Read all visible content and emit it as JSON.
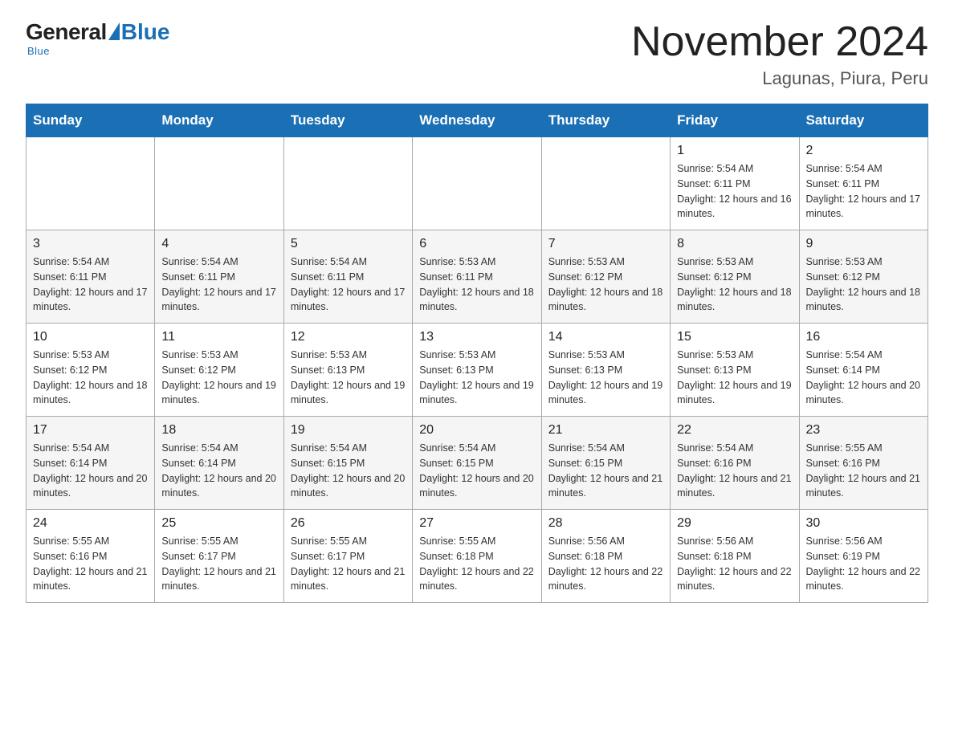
{
  "logo": {
    "general": "General",
    "blue": "Blue",
    "sub": "Blue"
  },
  "title": "November 2024",
  "subtitle": "Lagunas, Piura, Peru",
  "days_of_week": [
    "Sunday",
    "Monday",
    "Tuesday",
    "Wednesday",
    "Thursday",
    "Friday",
    "Saturday"
  ],
  "weeks": [
    [
      {
        "day": "",
        "sunrise": "",
        "sunset": "",
        "daylight": ""
      },
      {
        "day": "",
        "sunrise": "",
        "sunset": "",
        "daylight": ""
      },
      {
        "day": "",
        "sunrise": "",
        "sunset": "",
        "daylight": ""
      },
      {
        "day": "",
        "sunrise": "",
        "sunset": "",
        "daylight": ""
      },
      {
        "day": "",
        "sunrise": "",
        "sunset": "",
        "daylight": ""
      },
      {
        "day": "1",
        "sunrise": "Sunrise: 5:54 AM",
        "sunset": "Sunset: 6:11 PM",
        "daylight": "Daylight: 12 hours and 16 minutes."
      },
      {
        "day": "2",
        "sunrise": "Sunrise: 5:54 AM",
        "sunset": "Sunset: 6:11 PM",
        "daylight": "Daylight: 12 hours and 17 minutes."
      }
    ],
    [
      {
        "day": "3",
        "sunrise": "Sunrise: 5:54 AM",
        "sunset": "Sunset: 6:11 PM",
        "daylight": "Daylight: 12 hours and 17 minutes."
      },
      {
        "day": "4",
        "sunrise": "Sunrise: 5:54 AM",
        "sunset": "Sunset: 6:11 PM",
        "daylight": "Daylight: 12 hours and 17 minutes."
      },
      {
        "day": "5",
        "sunrise": "Sunrise: 5:54 AM",
        "sunset": "Sunset: 6:11 PM",
        "daylight": "Daylight: 12 hours and 17 minutes."
      },
      {
        "day": "6",
        "sunrise": "Sunrise: 5:53 AM",
        "sunset": "Sunset: 6:11 PM",
        "daylight": "Daylight: 12 hours and 18 minutes."
      },
      {
        "day": "7",
        "sunrise": "Sunrise: 5:53 AM",
        "sunset": "Sunset: 6:12 PM",
        "daylight": "Daylight: 12 hours and 18 minutes."
      },
      {
        "day": "8",
        "sunrise": "Sunrise: 5:53 AM",
        "sunset": "Sunset: 6:12 PM",
        "daylight": "Daylight: 12 hours and 18 minutes."
      },
      {
        "day": "9",
        "sunrise": "Sunrise: 5:53 AM",
        "sunset": "Sunset: 6:12 PM",
        "daylight": "Daylight: 12 hours and 18 minutes."
      }
    ],
    [
      {
        "day": "10",
        "sunrise": "Sunrise: 5:53 AM",
        "sunset": "Sunset: 6:12 PM",
        "daylight": "Daylight: 12 hours and 18 minutes."
      },
      {
        "day": "11",
        "sunrise": "Sunrise: 5:53 AM",
        "sunset": "Sunset: 6:12 PM",
        "daylight": "Daylight: 12 hours and 19 minutes."
      },
      {
        "day": "12",
        "sunrise": "Sunrise: 5:53 AM",
        "sunset": "Sunset: 6:13 PM",
        "daylight": "Daylight: 12 hours and 19 minutes."
      },
      {
        "day": "13",
        "sunrise": "Sunrise: 5:53 AM",
        "sunset": "Sunset: 6:13 PM",
        "daylight": "Daylight: 12 hours and 19 minutes."
      },
      {
        "day": "14",
        "sunrise": "Sunrise: 5:53 AM",
        "sunset": "Sunset: 6:13 PM",
        "daylight": "Daylight: 12 hours and 19 minutes."
      },
      {
        "day": "15",
        "sunrise": "Sunrise: 5:53 AM",
        "sunset": "Sunset: 6:13 PM",
        "daylight": "Daylight: 12 hours and 19 minutes."
      },
      {
        "day": "16",
        "sunrise": "Sunrise: 5:54 AM",
        "sunset": "Sunset: 6:14 PM",
        "daylight": "Daylight: 12 hours and 20 minutes."
      }
    ],
    [
      {
        "day": "17",
        "sunrise": "Sunrise: 5:54 AM",
        "sunset": "Sunset: 6:14 PM",
        "daylight": "Daylight: 12 hours and 20 minutes."
      },
      {
        "day": "18",
        "sunrise": "Sunrise: 5:54 AM",
        "sunset": "Sunset: 6:14 PM",
        "daylight": "Daylight: 12 hours and 20 minutes."
      },
      {
        "day": "19",
        "sunrise": "Sunrise: 5:54 AM",
        "sunset": "Sunset: 6:15 PM",
        "daylight": "Daylight: 12 hours and 20 minutes."
      },
      {
        "day": "20",
        "sunrise": "Sunrise: 5:54 AM",
        "sunset": "Sunset: 6:15 PM",
        "daylight": "Daylight: 12 hours and 20 minutes."
      },
      {
        "day": "21",
        "sunrise": "Sunrise: 5:54 AM",
        "sunset": "Sunset: 6:15 PM",
        "daylight": "Daylight: 12 hours and 21 minutes."
      },
      {
        "day": "22",
        "sunrise": "Sunrise: 5:54 AM",
        "sunset": "Sunset: 6:16 PM",
        "daylight": "Daylight: 12 hours and 21 minutes."
      },
      {
        "day": "23",
        "sunrise": "Sunrise: 5:55 AM",
        "sunset": "Sunset: 6:16 PM",
        "daylight": "Daylight: 12 hours and 21 minutes."
      }
    ],
    [
      {
        "day": "24",
        "sunrise": "Sunrise: 5:55 AM",
        "sunset": "Sunset: 6:16 PM",
        "daylight": "Daylight: 12 hours and 21 minutes."
      },
      {
        "day": "25",
        "sunrise": "Sunrise: 5:55 AM",
        "sunset": "Sunset: 6:17 PM",
        "daylight": "Daylight: 12 hours and 21 minutes."
      },
      {
        "day": "26",
        "sunrise": "Sunrise: 5:55 AM",
        "sunset": "Sunset: 6:17 PM",
        "daylight": "Daylight: 12 hours and 21 minutes."
      },
      {
        "day": "27",
        "sunrise": "Sunrise: 5:55 AM",
        "sunset": "Sunset: 6:18 PM",
        "daylight": "Daylight: 12 hours and 22 minutes."
      },
      {
        "day": "28",
        "sunrise": "Sunrise: 5:56 AM",
        "sunset": "Sunset: 6:18 PM",
        "daylight": "Daylight: 12 hours and 22 minutes."
      },
      {
        "day": "29",
        "sunrise": "Sunrise: 5:56 AM",
        "sunset": "Sunset: 6:18 PM",
        "daylight": "Daylight: 12 hours and 22 minutes."
      },
      {
        "day": "30",
        "sunrise": "Sunrise: 5:56 AM",
        "sunset": "Sunset: 6:19 PM",
        "daylight": "Daylight: 12 hours and 22 minutes."
      }
    ]
  ]
}
